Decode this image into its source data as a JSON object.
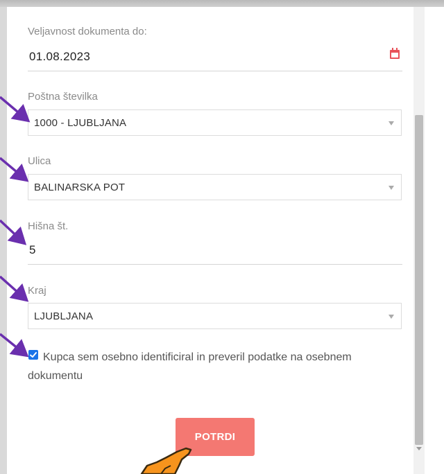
{
  "form": {
    "expiry": {
      "label": "Veljavnost dokumenta do:",
      "value": "01.08.2023",
      "icon": "calendar-icon"
    },
    "postal_code": {
      "label": "Poštna številka",
      "value": "1000 - LJUBLJANA"
    },
    "street": {
      "label": "Ulica",
      "value": "BALINARSKA POT"
    },
    "house_number": {
      "label": "Hišna št.",
      "value": "5"
    },
    "city": {
      "label": "Kraj",
      "value": "LJUBLJANA"
    },
    "confirmation_checkbox": {
      "checked": true,
      "label": "Kupca sem osebno identificiral in preveril podatke na osebnem dokumentu"
    },
    "confirm_button": {
      "label": "POTRDI"
    }
  },
  "colors": {
    "accent_red": "#e8525a",
    "button": "#f47872",
    "checkbox": "#1a73e8",
    "annotation_arrow": "#6a2fae",
    "annotation_hand": "#f7941d"
  }
}
